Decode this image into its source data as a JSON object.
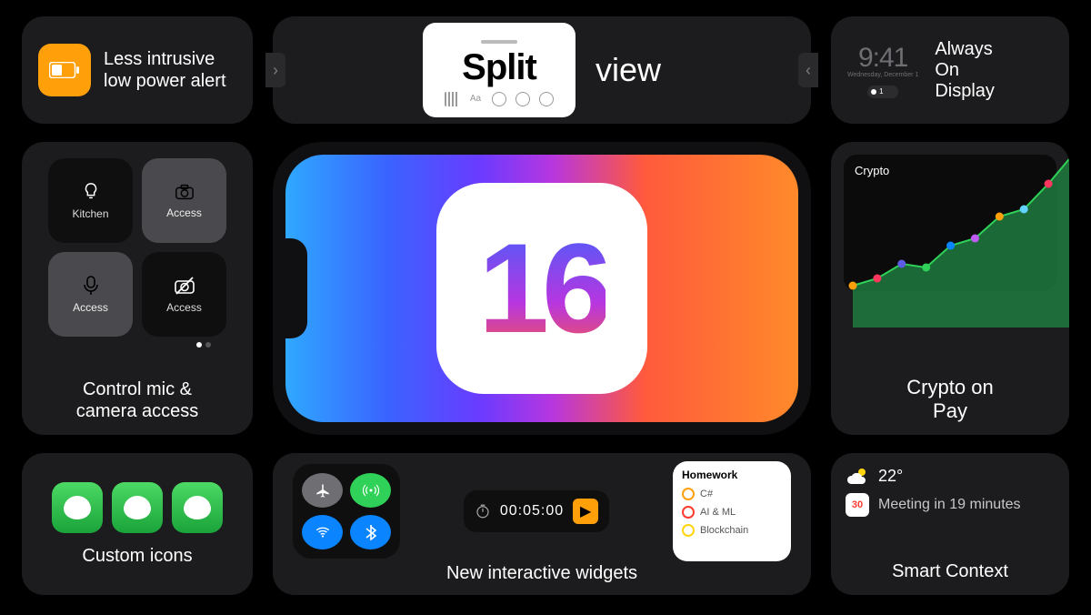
{
  "row1": {
    "low_power": {
      "line1": "Less intrusive",
      "line2": "low power alert"
    },
    "split_view": {
      "boxed_word": "Split",
      "outside_word": "view"
    },
    "aod": {
      "time": "9:41",
      "date": "Wednesday, December 1",
      "notif_count": "1",
      "line1": "Always",
      "line2": "On",
      "line3": "Display"
    }
  },
  "row2": {
    "control": {
      "tiles": [
        "Kitchen",
        "Access",
        "Access",
        "Access"
      ],
      "caption_l1": "Control mic &",
      "caption_l2": "camera access"
    },
    "ios_badge_number": "16",
    "crypto": {
      "widget_title": "Crypto",
      "caption_l1": "Crypto on",
      "caption_l2": " Pay"
    }
  },
  "row3": {
    "custom_icons_caption": "Custom icons",
    "widgets": {
      "timer_value": "00:05:00",
      "list_header": "Homework",
      "list_items": [
        "C#",
        "AI & ML",
        "Blockchain"
      ],
      "caption": "New interactive widgets"
    },
    "context": {
      "temperature": "22°",
      "calendar_day": "30",
      "meeting_text": "Meeting in 19 minutes",
      "caption": "Smart Context"
    }
  },
  "chart_data": {
    "type": "line",
    "title": "Crypto",
    "x": [
      0,
      1,
      2,
      3,
      4,
      5,
      6,
      7,
      8,
      9
    ],
    "values": [
      18,
      22,
      30,
      28,
      40,
      44,
      56,
      60,
      74,
      90
    ],
    "ylim": [
      0,
      100
    ],
    "points_colors": [
      "#ff9f0a",
      "#ff375f",
      "#5e5ce6",
      "#30d158",
      "#0a84ff",
      "#bf5af2",
      "#ff9f0a",
      "#64d2ff",
      "#ff375f",
      "#30d158"
    ]
  }
}
